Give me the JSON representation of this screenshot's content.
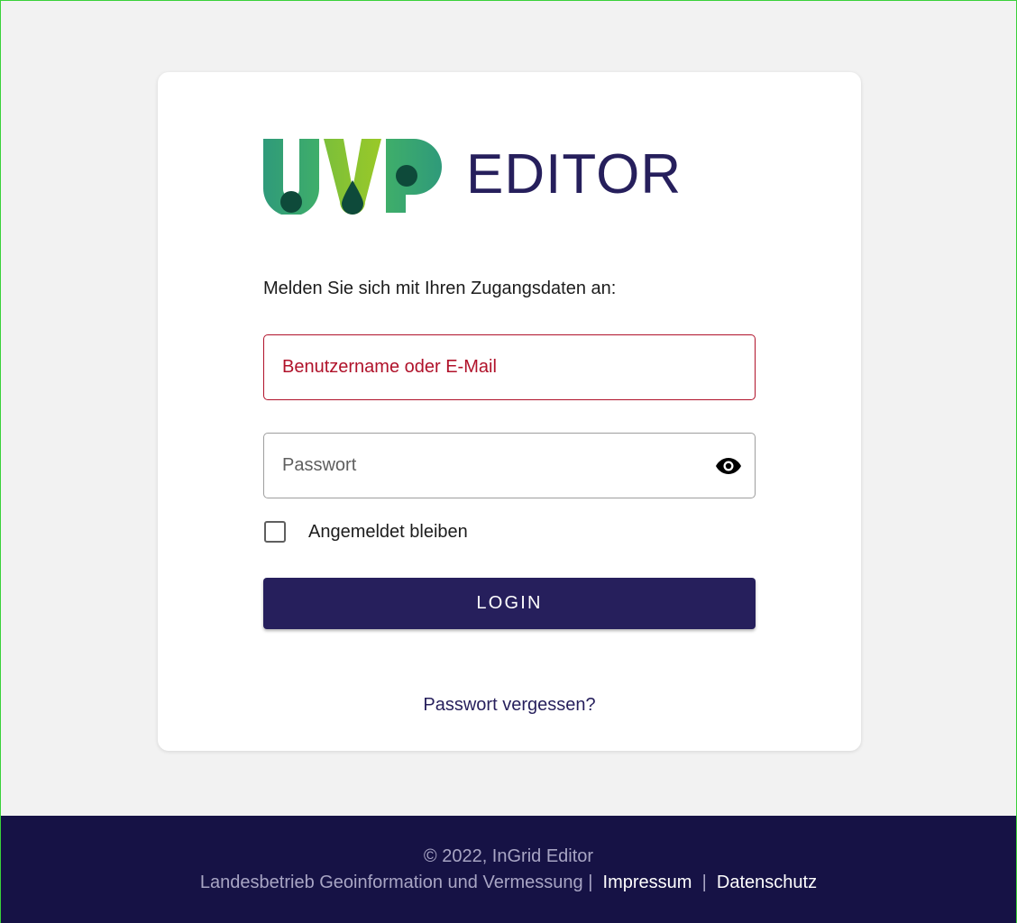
{
  "logo": {
    "mark_letters": "UVP",
    "word": "EDITOR"
  },
  "login": {
    "intro": "Melden Sie sich mit Ihren Zugangsdaten an:",
    "username_placeholder": "Benutzername oder E-Mail",
    "username_value": "",
    "password_placeholder": "Passwort",
    "password_value": "",
    "remember_label": "Angemeldet bleiben",
    "remember_checked": false,
    "login_button": "LOGIN",
    "forgot_link": "Passwort vergessen?"
  },
  "footer": {
    "copyright": "© 2022, InGrid Editor",
    "organization": "Landesbetrieb Geoinformation und Vermessung",
    "separator": "|",
    "impressum": "Impressum",
    "datenschutz": "Datenschutz"
  },
  "colors": {
    "page_background": "#f2f2f2",
    "brand_navy": "#261f5c",
    "footer_background": "#161245",
    "error_red": "#b0122a",
    "logo_green_dark": "#2f9a7a",
    "logo_green_light": "#8cc43a"
  },
  "icons": {
    "password_visibility": "eye-icon"
  }
}
